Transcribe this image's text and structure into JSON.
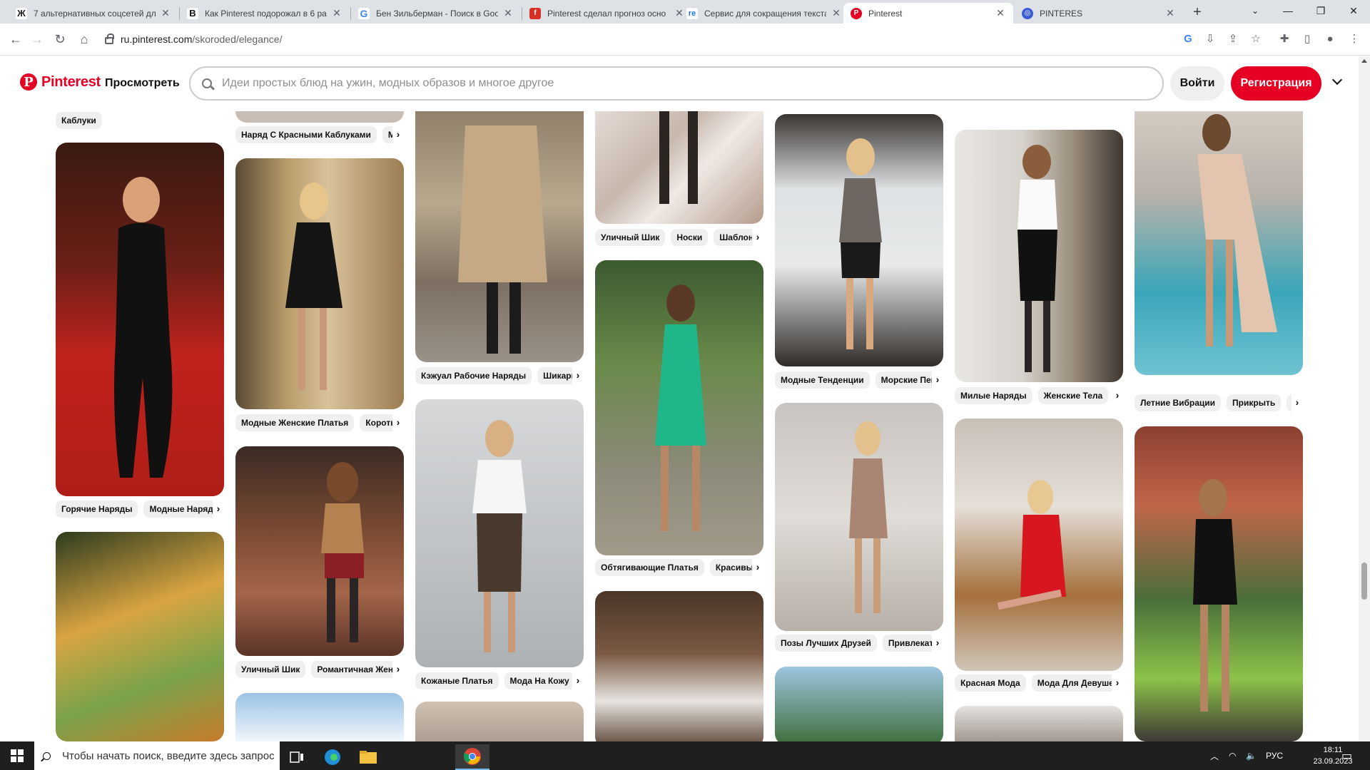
{
  "browser": {
    "tabs": [
      {
        "title": "7 альтернативных соцсетей дл",
        "favicon": "Ж",
        "fav_color": "#222222"
      },
      {
        "title": "Как Pinterest подорожал в 6 ра",
        "favicon": "B",
        "fav_color": "#111111"
      },
      {
        "title": "Бен Зильберман - Поиск в Goo",
        "favicon": "G",
        "fav_color": "#4285f4"
      },
      {
        "title": "Pinterest сделал прогноз осно",
        "favicon": "f",
        "fav_color": "#d93025"
      },
      {
        "title": "Сервис для сокращения текста",
        "favicon": "re",
        "fav_color": "#1a73e8"
      },
      {
        "title": "Pinterest",
        "favicon": "P",
        "fav_color": "#e60023"
      },
      {
        "title": "PINTERES",
        "favicon": "◎",
        "fav_color": "#3b5bdb"
      }
    ],
    "url_host": "ru.pinterest.com",
    "url_path": "/skoroded/elegance/"
  },
  "header": {
    "logo": "Pinterest",
    "browse": "Просмотреть",
    "search_placeholder": "Идеи простых блюд на ужин, модных образов и многое другое",
    "login": "Войти",
    "signup": "Регистрация"
  },
  "feed": {
    "top_tag": "Каблуки",
    "col1": [
      {
        "tags": [
          "Горячие Наряды",
          "Модные Наряды"
        ]
      },
      {
        "tags": []
      }
    ],
    "col2": [
      {
        "tags": [
          "Наряд С Красными Каблуками",
          "Мо"
        ]
      },
      {
        "tags": [
          "Модные Женские Платья",
          "Коротки"
        ]
      },
      {
        "tags": [
          "Уличный Шик",
          "Романтичная Женщ"
        ]
      }
    ],
    "col3": [
      {
        "tags": [
          "Кэжуал Рабочие Наряды",
          "Шикарны"
        ]
      },
      {
        "tags": [
          "Кожаные Платья",
          "Мода На Кожу"
        ]
      }
    ],
    "col4": [
      {
        "tags": [
          "Уличный Шик",
          "Носки",
          "Шаблоны"
        ]
      },
      {
        "tags": [
          "Обтягивающие Платья",
          "Красивые З"
        ]
      }
    ],
    "col5": [
      {
        "tags": [
          "Модные Тенденции",
          "Морские Пей"
        ]
      },
      {
        "tags": [
          "Позы Лучших Друзей",
          "Привлекате"
        ]
      }
    ],
    "col6": [
      {
        "tags": [
          "Милые Наряды",
          "Женские Тела",
          "Ч"
        ]
      },
      {
        "tags": [
          "Красная Мода",
          "Мода Для Девушек"
        ]
      }
    ],
    "col7": [
      {
        "tags": [
          "Летние Вибрации",
          "Прикрыть",
          "Пл"
        ]
      }
    ]
  },
  "taskbar": {
    "search_placeholder": "Чтобы начать поиск, введите здесь запрос",
    "lang": "РУС",
    "time": "18:11",
    "date": "23.09.2023"
  }
}
